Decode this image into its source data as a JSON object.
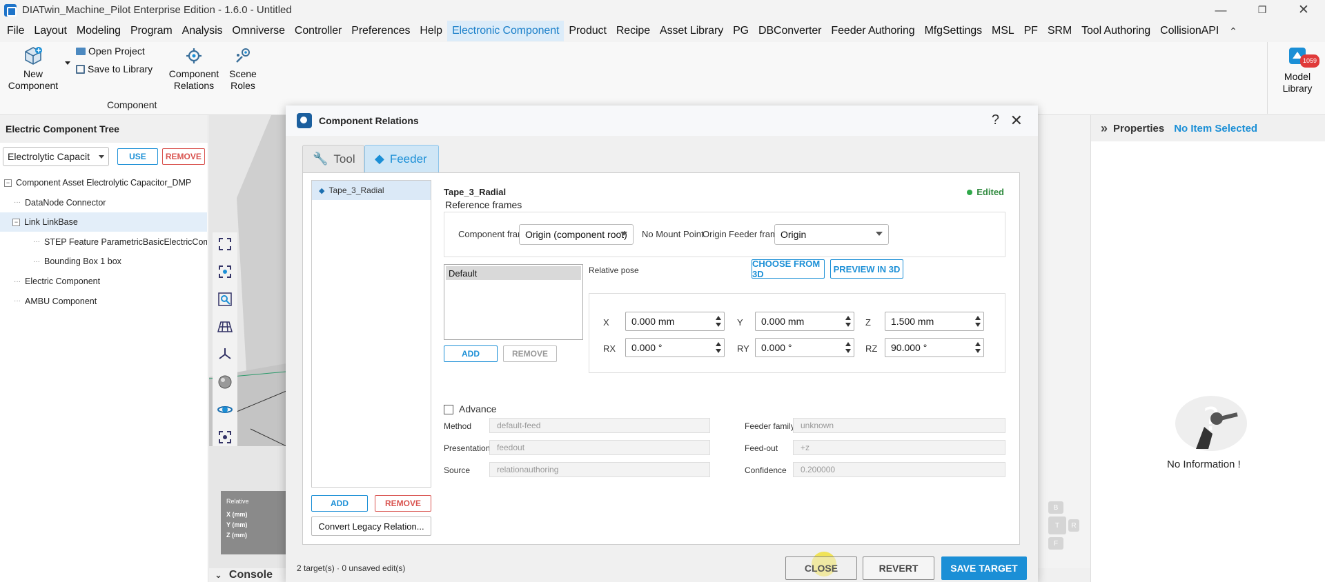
{
  "window": {
    "title": "DIATwin_Machine_Pilot Enterprise Edition - 1.6.0 - Untitled"
  },
  "menu": [
    "File",
    "Layout",
    "Modeling",
    "Program",
    "Analysis",
    "Omniverse",
    "Controller",
    "Preferences",
    "Help",
    "Electronic Component",
    "Product",
    "Recipe",
    "Asset Library",
    "PG",
    "DBConverter",
    "Feeder Authoring",
    "MfgSettings",
    "MSL",
    "PF",
    "SRM",
    "Tool Authoring",
    "CollisionAPI"
  ],
  "menu_active": "Electronic Component",
  "ribbon": {
    "new_component": "New Component",
    "open_project": "Open Project",
    "save_to_library": "Save to Library",
    "component_relations": "Component Relations",
    "scene_roles": "Scene Roles",
    "group_label": "Component",
    "model_library": "Model Library",
    "model_library_badge": "1059"
  },
  "left_panel": {
    "title": "Electric Component Tree",
    "select_value": "Electrolytic Capacit",
    "use_label": "USE",
    "remove_label": "REMOVE",
    "tree": [
      {
        "label": "Component Asset  Electrolytic Capacitor_DMP",
        "toggle": "−"
      },
      {
        "label": "DataNode  Connector"
      },
      {
        "label": "Link  LinkBase",
        "toggle": "−"
      },
      {
        "label": "STEP Feature  ParametricBasicElectricCom..."
      },
      {
        "label": "Bounding Box  1 box"
      },
      {
        "label": "Electric Component"
      },
      {
        "label": "AMBU Component"
      }
    ]
  },
  "viewport": {
    "coords": {
      "title": "Relative",
      "x": "X (mm)",
      "y": "Y (mm)",
      "z": "Z (mm)"
    },
    "console": "Console"
  },
  "nav_cube": {
    "b": "B",
    "t": "T",
    "r": "R",
    "f": "F"
  },
  "right_panel": {
    "title": "Properties",
    "status": "No Item Selected",
    "no_info": "No Information !"
  },
  "dialog": {
    "title": "Component Relations",
    "help": "?",
    "close": "✕",
    "tabs": [
      "Tool",
      "Feeder"
    ],
    "active_tab": "Feeder",
    "targets": [
      "Tape_3_Radial"
    ],
    "add_label": "ADD",
    "remove_label": "REMOVE",
    "convert_label": "Convert Legacy Relation...",
    "detail": {
      "name": "Tape_3_Radial",
      "status": "Edited",
      "reference_frames": "Reference frames",
      "component_frame_label": "Component frame",
      "component_frame_value": "Origin (component root)",
      "no_mount_point": "No Mount Point",
      "origin": "Origin",
      "feeder_frame_label": "Feeder frame",
      "feeder_frame_value": "Origin",
      "poses": [
        "Default"
      ],
      "relative_pose": "Relative pose",
      "choose_from_3d": "CHOOSE FROM 3D",
      "preview_in_3d": "PREVIEW IN 3D",
      "pose_add": "ADD",
      "pose_remove": "REMOVE",
      "x_label": "X",
      "x_value": "0.000 mm",
      "y_label": "Y",
      "y_value": "0.000 mm",
      "z_label": "Z",
      "z_value": "1.500 mm",
      "rx_label": "RX",
      "rx_value": "0.000 °",
      "ry_label": "RY",
      "ry_value": "0.000 °",
      "rz_label": "RZ",
      "rz_value": "90.000 °",
      "advance": "Advance",
      "method_label": "Method",
      "method_value": "default-feed",
      "feeder_family_label": "Feeder family",
      "feeder_family_value": "unknown",
      "presentation_label": "Presentation",
      "presentation_value": "feedout",
      "feed_out_label": "Feed-out",
      "feed_out_value": "+z",
      "source_label": "Source",
      "source_value": "relationauthoring",
      "confidence_label": "Confidence",
      "confidence_value": "0.200000"
    },
    "status_line": "2 target(s) · 0 unsaved edit(s)",
    "close_btn": "CLOSE",
    "revert_btn": "REVERT",
    "save_btn": "SAVE TARGET"
  }
}
